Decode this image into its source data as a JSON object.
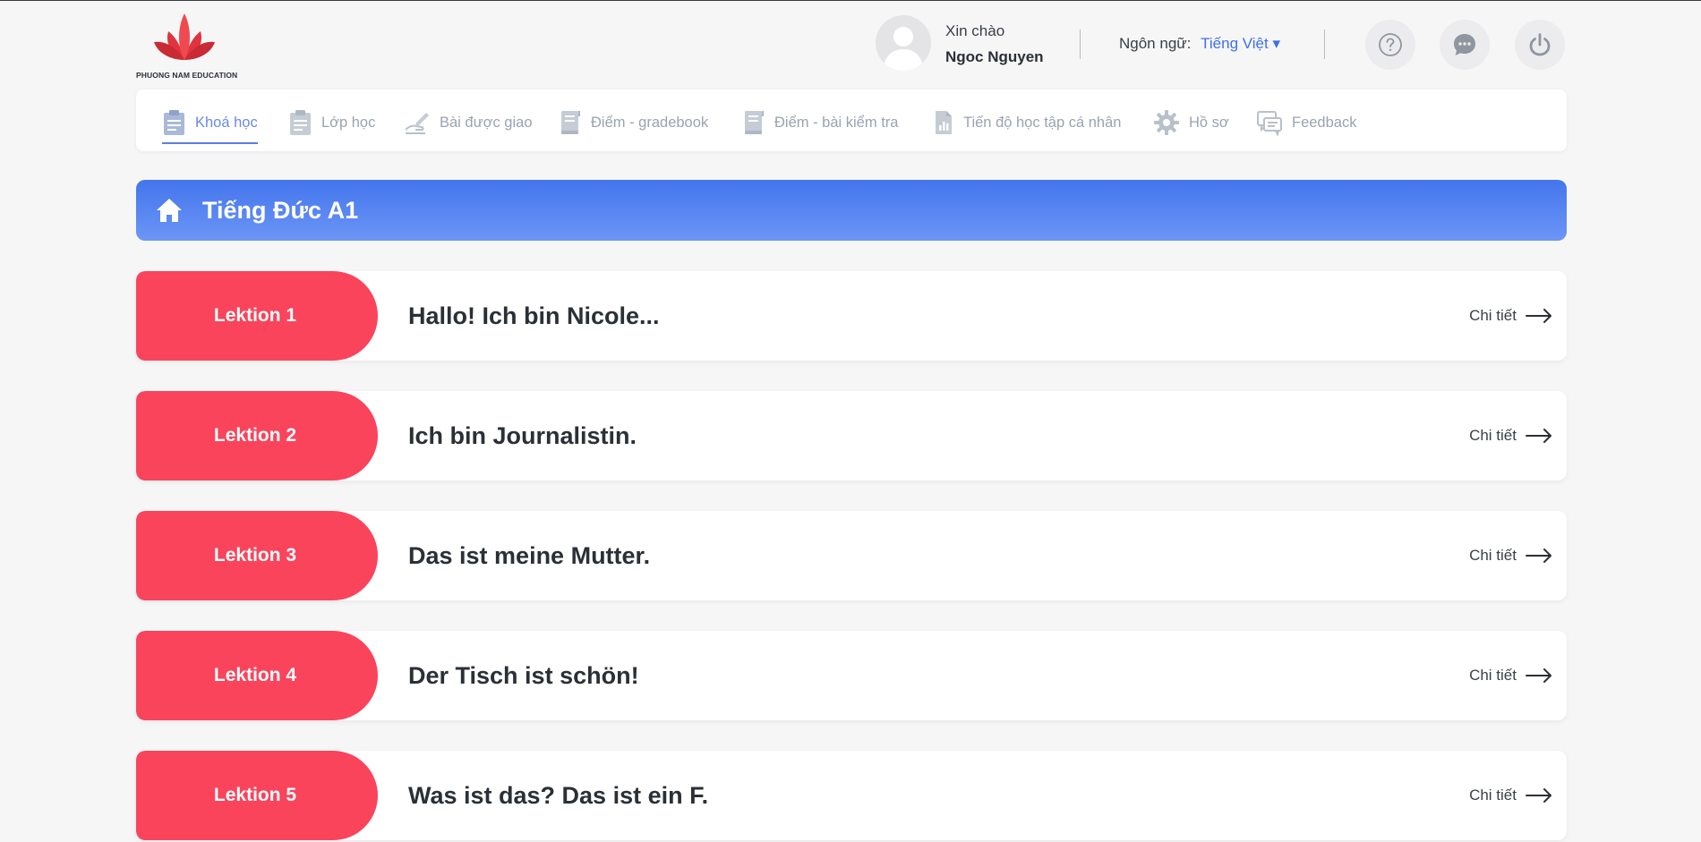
{
  "brand": {
    "name": "PHUONG NAM EDUCATION",
    "primary": "#f9445c",
    "accent": "#4375ec"
  },
  "user": {
    "greeting": "Xin chào",
    "name": "Ngoc Nguyen"
  },
  "language": {
    "label": "Ngôn ngữ:",
    "value": "Tiếng Việt ▾"
  },
  "header_icons": [
    "help-icon",
    "chat-icon",
    "power-icon"
  ],
  "nav": {
    "items": [
      {
        "label": "Khoá học",
        "icon": "clipboard-icon",
        "active": true
      },
      {
        "label": "Lớp học",
        "icon": "clipboard-icon",
        "active": false
      },
      {
        "label": "Bài được giao",
        "icon": "hand-pen-icon",
        "active": false
      },
      {
        "label": "Điểm - gradebook",
        "icon": "book-icon",
        "active": false
      },
      {
        "label": "Điểm - bài kiểm tra",
        "icon": "book-icon",
        "active": false
      },
      {
        "label": "Tiến độ học tập cá nhân",
        "icon": "report-chart-icon",
        "active": false
      },
      {
        "label": "Hồ sơ",
        "icon": "gear-icon",
        "active": false
      },
      {
        "label": "Feedback",
        "icon": "feedback-icon",
        "active": false
      }
    ]
  },
  "course": {
    "title": "Tiếng Đức A1",
    "icon": "home-icon"
  },
  "lessons": [
    {
      "tag": "Lektion 1",
      "title": "Hallo! Ich bin Nicole...",
      "action": "Chi tiết"
    },
    {
      "tag": "Lektion 2",
      "title": "Ich bin Journalistin.",
      "action": "Chi tiết"
    },
    {
      "tag": "Lektion 3",
      "title": "Das ist meine Mutter.",
      "action": "Chi tiết"
    },
    {
      "tag": "Lektion 4",
      "title": "Der Tisch ist schön!",
      "action": "Chi tiết"
    },
    {
      "tag": "Lektion 5",
      "title": "Was ist das? Das ist ein F.",
      "action": "Chi tiết"
    }
  ]
}
